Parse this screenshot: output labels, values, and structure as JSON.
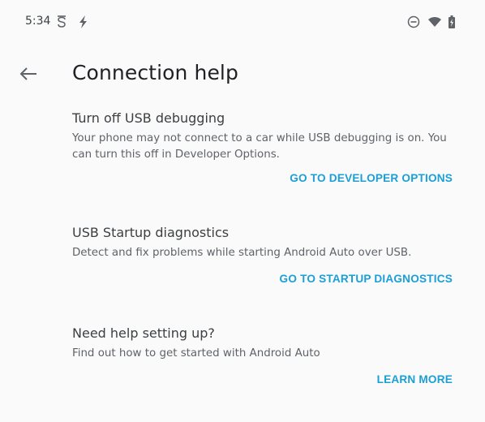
{
  "status_bar": {
    "time": "5:34",
    "left_icons": [
      "sync-s-icon",
      "flash-icon"
    ],
    "right_icons": [
      "do-not-disturb-icon",
      "wifi-icon",
      "battery-charging-icon"
    ]
  },
  "toolbar": {
    "back_icon": "arrow-back-icon",
    "title": "Connection help"
  },
  "sections": [
    {
      "title": "Turn off USB debugging",
      "description": "Your phone may not connect to a car while USB debugging is on. You can turn this off in Developer Options.",
      "action_label": "GO TO DEVELOPER OPTIONS"
    },
    {
      "title": "USB Startup diagnostics",
      "description": "Detect and fix problems while starting Android Auto over USB.",
      "action_label": "GO TO STARTUP DIAGNOSTICS"
    },
    {
      "title": "Need help setting up?",
      "description": "Find out how to get started with Android Auto",
      "action_label": "LEARN MORE"
    }
  ],
  "colors": {
    "background": "#fafafa",
    "accent": "#1a9fd6",
    "title_text": "#202124",
    "secondary_text": "#5f6368"
  }
}
